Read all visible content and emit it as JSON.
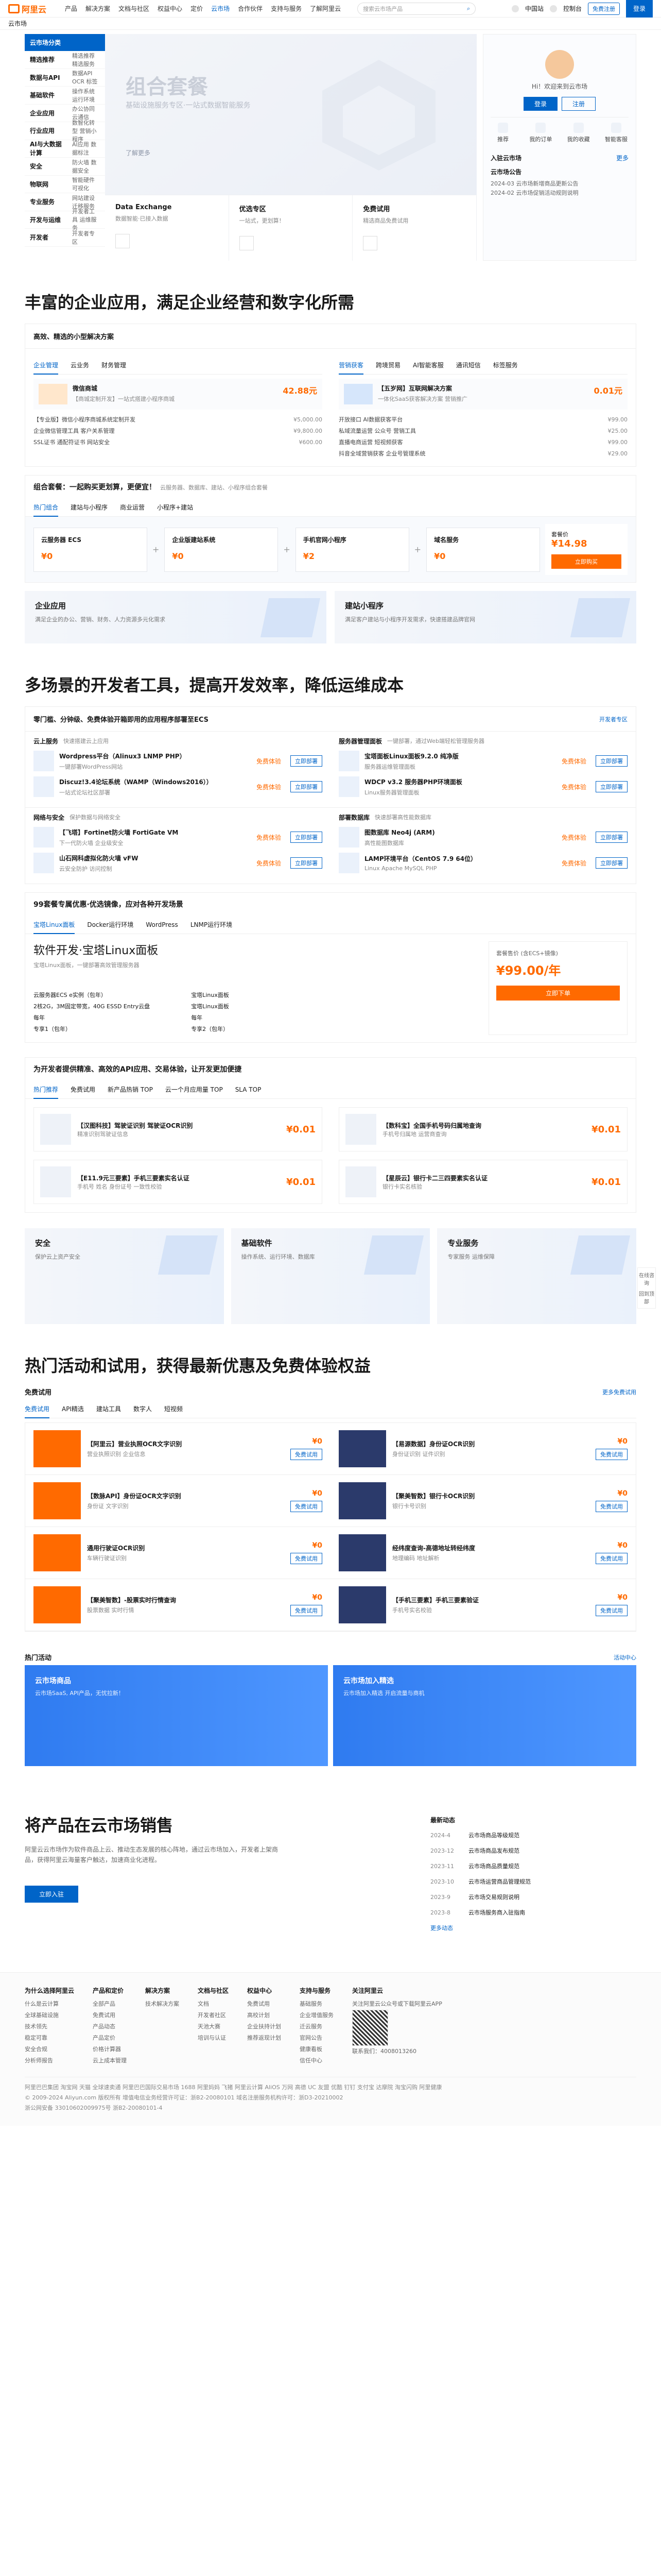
{
  "header": {
    "logo": "阿里云",
    "nav": [
      "产品",
      "解决方案",
      "文档与社区",
      "权益中心",
      "定价",
      "云市场",
      "合作伙伴",
      "支持与服务",
      "了解阿里云"
    ],
    "active": "云市场",
    "search_placeholder": "搜索云市场产品",
    "right": [
      "中国站",
      "控制台"
    ],
    "register": "免费注册",
    "login": "登录"
  },
  "subnav": "云市场",
  "categories": {
    "title": "云市场分类",
    "items": [
      {
        "k": "精选推荐",
        "v": "精选推荐  精选服务"
      },
      {
        "k": "数据与API",
        "v": "数据API  OCR  标签"
      },
      {
        "k": "基础软件",
        "v": "操作系统  运行环境"
      },
      {
        "k": "企业应用",
        "v": "办公协同  云通信"
      },
      {
        "k": "行业应用",
        "v": "数智化转型  营销小程序"
      },
      {
        "k": "AI与大数据计算",
        "v": "AI应用  数据标注"
      },
      {
        "k": "安全",
        "v": "防火墙  数据安全"
      },
      {
        "k": "物联网",
        "v": "智能硬件  可视化"
      },
      {
        "k": "专业服务",
        "v": "网站建设  迁移服务"
      },
      {
        "k": "开发与运维",
        "v": "开发者工具  运维服务"
      },
      {
        "k": "开发者",
        "v": "开发者专区"
      }
    ]
  },
  "banner": {
    "title": "组合套餐",
    "subtitle": "基础设施服务专区·一站式数据智能服务",
    "link": "了解更多"
  },
  "tiles": [
    {
      "t": "Data Exchange",
      "d": "数据智能·已接入数据"
    },
    {
      "t": "优选专区",
      "d": "一站式，更划算！"
    },
    {
      "t": "免费试用",
      "d": "精选商品免费试用"
    }
  ],
  "user": {
    "greeting": "Hi！欢迎来到云市场",
    "login": "登录",
    "register": "注册",
    "quick": [
      "推荐",
      "我的订单",
      "我的收藏",
      "智能客服"
    ],
    "apply": "入驻云市场",
    "apply_more": "更多",
    "notice": "云市场公告",
    "notices": [
      "2024-03 云市场新增商品更新公告",
      "2024-02 云市场促销活动规则说明"
    ]
  },
  "sec1": "丰富的企业应用，满足企业经营和数字化所需",
  "sub1": "高效、精选的小型解决方案",
  "tabsL": [
    "企业管理",
    "云业务",
    "财务管理"
  ],
  "tabsR": [
    "营销获客",
    "跨境贸易",
    "AI智能客服",
    "通讯短信",
    "标签服务"
  ],
  "left": {
    "hero": {
      "t": "微信商城",
      "d": "【商城定制开发】一站式搭建小程序商城",
      "p": "42.88元"
    },
    "list": [
      {
        "t": "【专业版】微信小程序商城系统定制开发",
        "p": "¥5,000.00"
      },
      {
        "t": "企业微信管理工具 客户关系管理",
        "p": "¥9,800.00"
      },
      {
        "t": "SSL证书 通配符证书 网站安全",
        "p": "¥600.00"
      }
    ]
  },
  "right": {
    "hero": {
      "t": "【五岁网】互联网解决方案",
      "d": "一体化SaaS获客解决方案 营销推广",
      "p": "0.01元"
    },
    "list": [
      {
        "t": "开放接口 AI数据获客平台",
        "p": "¥99.00"
      },
      {
        "t": "私域流量运营 公众号 营销工具",
        "p": "¥25.00"
      },
      {
        "t": "直播电商运营 短视频获客",
        "p": "¥99.00"
      },
      {
        "t": "抖音全域营销获客 企业号管理系统",
        "p": "¥29.00"
      }
    ]
  },
  "combo": {
    "title": "组合套餐：一起购买更划算，更便宜！",
    "note": "云服务器、数据库、建站、小程序组合套餐",
    "tabs": [
      "热门组合",
      "建站与小程序",
      "商业运营",
      "小程序+建站"
    ],
    "items": [
      {
        "t": "云服务器 ECS",
        "p": "¥0"
      },
      {
        "t": "企业版建站系统",
        "p": "¥0"
      },
      {
        "t": "手机官网小程序",
        "p": "¥2"
      },
      {
        "t": "域名服务",
        "p": "¥0"
      }
    ],
    "buy": {
      "label": "套餐价",
      "price": "¥14.98",
      "btn": "立即购买"
    }
  },
  "cards1": [
    {
      "t": "企业应用",
      "d": "满足企业的办公、营销、财务、人力资源多元化需求"
    },
    {
      "t": "建站小程序",
      "d": "满足客户建站与小程序开发需求，快速搭建品牌官网"
    }
  ],
  "sec2": "多场景的开发者工具，提高开发效率，降低运维成本",
  "dev": {
    "title": "零门槛、分钟级、免费体验开箱即用的应用程序部署至ECS",
    "more": "开发者专区",
    "groups": [
      {
        "lb": "云上服务",
        "d": "快速搭建云上应用",
        "items": [
          {
            "t": "Wordpress平台（Alinux3 LNMP PHP）",
            "d": "一键部署WordPress网站",
            "p": "免费体验",
            "b": "立即部署"
          },
          {
            "t": "Discuz!3.4论坛系统（WAMP（Windows2016））",
            "d": "一站式论坛社区部署",
            "p": "免费体验",
            "b": "立即部署"
          }
        ]
      },
      {
        "lb": "服务器管理面板",
        "d": "一键部署，通过Web端轻松管理服务器",
        "items": [
          {
            "t": "宝塔面板Linux面板9.2.0 纯净版",
            "d": "服务器运维管理面板",
            "p": "免费体验",
            "b": "立即部署"
          },
          {
            "t": "WDCP v3.2 服务器PHP环境面板",
            "d": "Linux服务器管理面板",
            "p": "免费体验",
            "b": "立即部署"
          }
        ]
      },
      {
        "lb": "网络与安全",
        "d": "保护数据与网络安全",
        "items": [
          {
            "t": "【飞塔】Fortinet防火墙 FortiGate VM",
            "d": "下一代防火墙 企业级安全",
            "p": "免费体验",
            "b": "立即部署"
          },
          {
            "t": "山石网科虚拟化防火墙 vFW",
            "d": "云安全防护 访问控制",
            "p": "免费体验",
            "b": "立即部署"
          }
        ]
      },
      {
        "lb": "部署数据库",
        "d": "快速部署高性能数据库",
        "items": [
          {
            "t": "图数据库 Neo4j (ARM)",
            "d": "高性能图数据库",
            "p": "免费体验",
            "b": "立即部署"
          },
          {
            "t": "LAMP环境平台（CentOS 7.9 64位）",
            "d": "Linux Apache MySQL PHP",
            "p": "免费体验",
            "b": "立即部署"
          }
        ]
      }
    ]
  },
  "vm": {
    "title": "99套餐专属优惠·优选镜像，应对各种开发场景",
    "tabs": [
      "宝塔Linux面板",
      "Docker运行环境",
      "WordPress",
      "LNMP运行环境"
    ],
    "name": "软件开发·宝塔Linux面板",
    "desc": "宝塔Linux面板，一键部署高效管理服务器",
    "cols": [
      [
        "云服务器ECS e实例（包年）",
        "2核2G，3M固定带宽，40G ESSD Entry云盘",
        "每年",
        "专享1（包年）"
      ],
      [
        "宝塔Linux面板",
        "宝塔Linux面板",
        "每年",
        "专享2（包年）"
      ]
    ],
    "price_note": "套餐售价 (含ECS+镜像)",
    "price": "¥99.00/年",
    "btn": "立即下单"
  },
  "hotapi": {
    "title": "为开发者提供精准、高效的API应用、交易体验，让开发更加便捷",
    "tabs": [
      "热门推荐",
      "免费试用",
      "新产品热销 TOP",
      "云一个月应用量 TOP",
      "SLA TOP"
    ],
    "items": [
      {
        "t": "【汉图科技】驾驶证识别 驾驶证OCR识别",
        "d": "精准识别驾驶证信息",
        "p": "¥0.01"
      },
      {
        "t": "【数科宝】全国手机号码归属地查询",
        "d": "手机号归属地 运营商查询",
        "p": "¥0.01"
      },
      {
        "t": "【E11.9元三要素】手机三要素实名认证",
        "d": "手机号 姓名 身份证号 一致性校验",
        "p": "¥0.01"
      },
      {
        "t": "【星辰云】银行卡二三四要素实名认证",
        "d": "银行卡实名核验",
        "p": "¥0.01"
      }
    ]
  },
  "cards2": [
    {
      "t": "安全",
      "d": "保护云上资产安全"
    },
    {
      "t": "基础软件",
      "d": "操作系统、运行环境、数据库"
    },
    {
      "t": "专业服务",
      "d": "专家服务 运维保障"
    }
  ],
  "sec3": "热门活动和试用，获得最新优惠及免费体验权益",
  "trial": {
    "title": "免费试用",
    "tabs": [
      "免费试用",
      "API精选",
      "建站工具",
      "数字人",
      "短视频"
    ],
    "more": "更多免费试用",
    "items": [
      {
        "t": "【阿里云】营业执照OCR文字识别",
        "d": "营业执照识别 企业信息",
        "p": "¥0",
        "b": "免费试用"
      },
      {
        "t": "【易源数据】身份证OCR识别",
        "d": "身份证识别 证件识别",
        "p": "¥0",
        "b": "免费试用"
      },
      {
        "t": "【数脉API】身份证OCR文字识别",
        "d": "身份证 文字识别",
        "p": "¥0",
        "b": "免费试用"
      },
      {
        "t": "【聚美智数】银行卡OCR识别",
        "d": "银行卡号识别",
        "p": "¥0",
        "b": "免费试用"
      },
      {
        "t": "通用行驶证OCR识别",
        "d": "车辆行驶证识别",
        "p": "¥0",
        "b": "免费试用"
      },
      {
        "t": "经纬度查询-高德地址转经纬度",
        "d": "地理编码 地址解析",
        "p": "¥0",
        "b": "免费试用"
      },
      {
        "t": "【聚美智数】-股票实时行情查询",
        "d": "股票数据 实时行情",
        "p": "¥0",
        "b": "免费试用"
      },
      {
        "t": "【手机三要素】手机三要素验证",
        "d": "手机号实名校验",
        "p": "¥0",
        "b": "免费试用"
      }
    ]
  },
  "activity": {
    "title": "热门活动",
    "more": "活动中心",
    "a": [
      {
        "t": "云市场商品",
        "d": "云市场SaaS, API产品，无忧拉新！"
      },
      {
        "t": "云市场加入精选",
        "d": "云市场加入精选 开启流量与商机"
      }
    ]
  },
  "sell": {
    "title": "将产品在云市场销售",
    "desc": "阿里云云市场作为软件商品上云、推动生态发展的核心阵地，通过云市场加入，开发者上架商品，获得阿里云海量客户触达，加速商业化进程。",
    "btn": "立即入驻",
    "news_title": "最新动态",
    "news": [
      [
        "2024-4",
        "云市场商品等级规范"
      ],
      [
        "2023-12",
        "云市场商品发布规范"
      ],
      [
        "2023-11",
        "云市场商品质量规范"
      ],
      [
        "2023-10",
        "云市场运营商品管理规范"
      ],
      [
        "2023-9",
        "云市场交易规则说明"
      ],
      [
        "2023-8",
        "云市场服务商入驻指南"
      ]
    ],
    "more": "更多动态"
  },
  "footer": {
    "cols": [
      {
        "h": "为什么选择阿里云",
        "i": [
          "什么是云计算",
          "全球基础设施",
          "技术领先",
          "稳定可靠",
          "安全合规",
          "分析师报告"
        ]
      },
      {
        "h": "产品和定价",
        "i": [
          "全部产品",
          "免费试用",
          "产品动态",
          "产品定价",
          "价格计算器",
          "云上成本管理"
        ]
      },
      {
        "h": "解决方案",
        "i": [
          "技术解决方案"
        ]
      },
      {
        "h": "文档与社区",
        "i": [
          "文档",
          "开发者社区",
          "天池大赛",
          "培训与认证"
        ]
      },
      {
        "h": "权益中心",
        "i": [
          "免费试用",
          "高校计划",
          "企业扶持计划",
          "推荐返现计划"
        ]
      },
      {
        "h": "支持与服务",
        "i": [
          "基础服务",
          "企业增值服务",
          "迁云服务",
          "官网公告",
          "健康看板",
          "信任中心"
        ]
      },
      {
        "h": "关注阿里云",
        "i": [
          "关注阿里云公众号或下载阿里云APP",
          "联系我们：4008013260"
        ]
      }
    ],
    "links": "阿里巴巴集团  淘宝网  天猫  全球速卖通  阿里巴巴国际交易市场  1688  阿里妈妈  飞猪  阿里云计算  AliOS  万网  高德  UC  友盟  优酷  钉钉  支付宝  达摩院  淘宝闪购  阿里健康",
    "copy": "© 2009-2024 Aliyun.com 版权所有 增值电信业务经营许可证：浙B2-20080101 域名注册服务机构许可：浙D3-20210002",
    "icp": "浙公网安备 33010602009975号  浙B2-20080101-4"
  },
  "float": [
    "在线咨询",
    "回到顶部"
  ]
}
